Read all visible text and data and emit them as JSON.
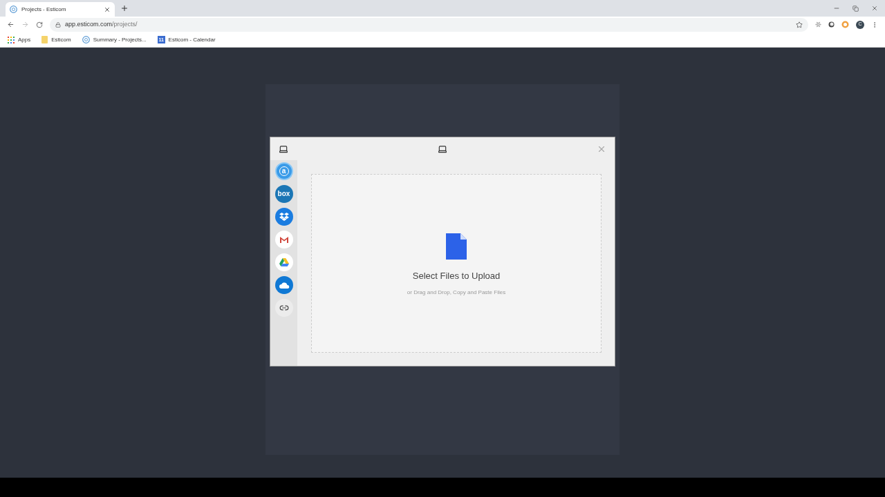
{
  "browser": {
    "tabs": [
      {
        "title": "Projects - Esticom",
        "selected": true
      }
    ],
    "address": {
      "host": "app.esticom.com",
      "path": "/projects/"
    },
    "bookmarks": [
      {
        "kind": "apps",
        "label": "Apps"
      },
      {
        "kind": "folder",
        "label": "Esticom"
      },
      {
        "kind": "site",
        "label": "Summary - Projects..."
      },
      {
        "kind": "calendar",
        "label": "Esticom - Calendar",
        "badge": "11"
      }
    ],
    "profile": "C"
  },
  "dialog": {
    "sources": [
      {
        "kind": "amazon",
        "label": "a"
      },
      {
        "kind": "box",
        "label": "box"
      },
      {
        "kind": "dropbox"
      },
      {
        "kind": "gmail"
      },
      {
        "kind": "drive"
      },
      {
        "kind": "onedrive"
      },
      {
        "kind": "link"
      }
    ],
    "drop_zone": {
      "title": "Select Files to Upload",
      "subtitle": "or Drag and Drop, Copy and Paste Files"
    }
  }
}
